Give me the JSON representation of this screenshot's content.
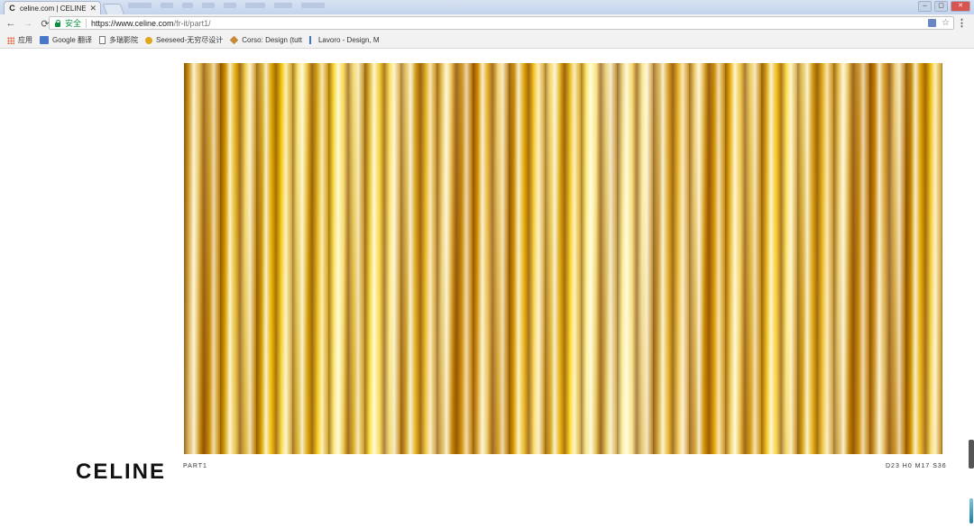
{
  "browser": {
    "tab_title": "celine.com | CELINE SI",
    "tab_favicon": "C",
    "tab_close": "✕",
    "secure_label": "安全",
    "url_host": "https://www.celine.com",
    "url_path": "/fr-it/part1/",
    "back_glyph": "←",
    "forward_glyph": "→",
    "reload_glyph": "⟳",
    "star_glyph": "☆",
    "menu_glyph": "⋮",
    "win_minimize": "–",
    "win_maximize": "▢",
    "win_close": "✕"
  },
  "bookmarks": [
    {
      "label": "应用",
      "icon": "apps-icon"
    },
    {
      "label": "Google 翻译",
      "icon": "google-translate-icon"
    },
    {
      "label": "多瑞影院",
      "icon": "document-icon"
    },
    {
      "label": "Seeseed-无穷尽设计",
      "icon": "seeseed-icon"
    },
    {
      "label": "Corso: Design (tutt",
      "icon": "corso-icon"
    },
    {
      "label": "Lavoro - Design, M",
      "icon": "lavoro-icon"
    }
  ],
  "page": {
    "logo": "CELINE",
    "part_label": "PART1",
    "counter": "D23 H0 M17 S36",
    "hero_image": "gold-foil-fabric-image"
  },
  "colors": {
    "accent_gold": "#f2c200",
    "secure_green": "#0a8f3d",
    "logo_black": "#111111"
  }
}
